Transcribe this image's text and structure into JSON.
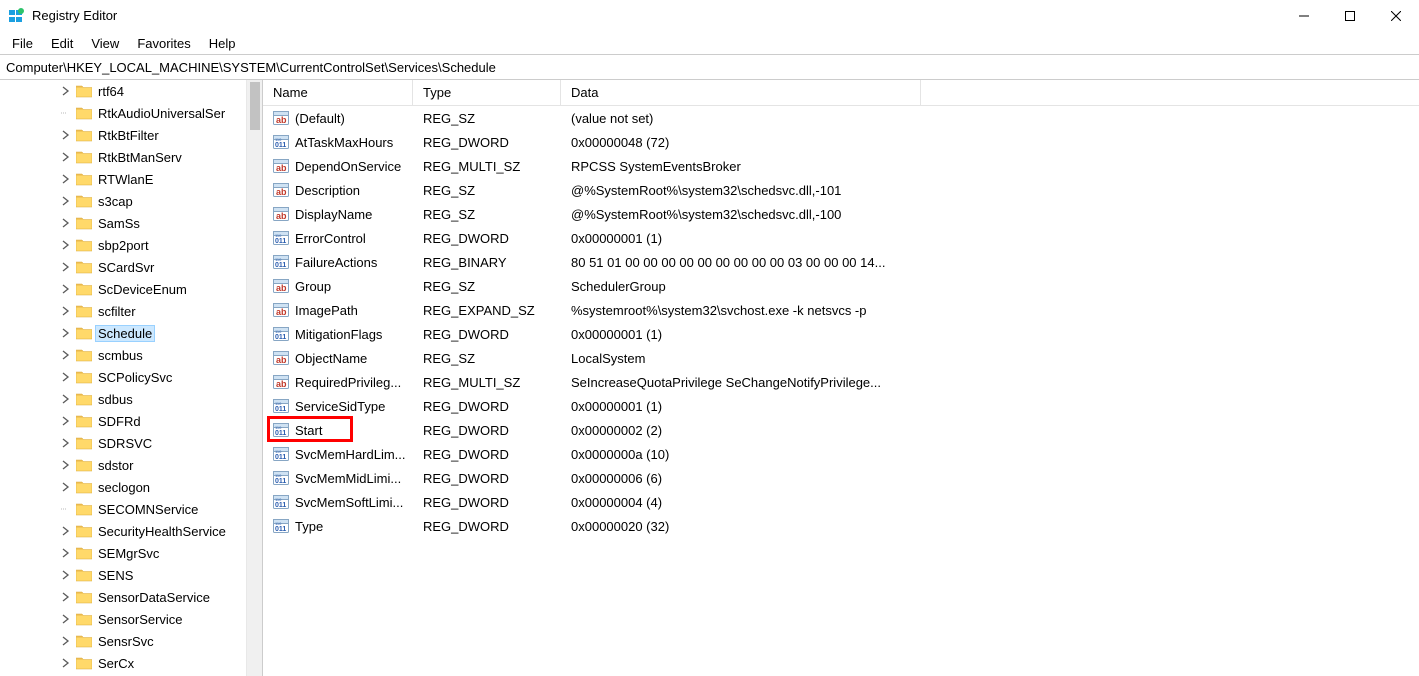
{
  "titlebar": {
    "title": "Registry Editor"
  },
  "menus": [
    "File",
    "Edit",
    "View",
    "Favorites",
    "Help"
  ],
  "address": "Computer\\HKEY_LOCAL_MACHINE\\SYSTEM\\CurrentControlSet\\Services\\Schedule",
  "tree": [
    {
      "label": "rtf64",
      "expandable": true
    },
    {
      "label": "RtkAudioUniversalSer",
      "expandable": false
    },
    {
      "label": "RtkBtFilter",
      "expandable": true
    },
    {
      "label": "RtkBtManServ",
      "expandable": true
    },
    {
      "label": "RTWlanE",
      "expandable": true
    },
    {
      "label": "s3cap",
      "expandable": true
    },
    {
      "label": "SamSs",
      "expandable": true
    },
    {
      "label": "sbp2port",
      "expandable": true
    },
    {
      "label": "SCardSvr",
      "expandable": true
    },
    {
      "label": "ScDeviceEnum",
      "expandable": true
    },
    {
      "label": "scfilter",
      "expandable": true
    },
    {
      "label": "Schedule",
      "expandable": true,
      "selected": true
    },
    {
      "label": "scmbus",
      "expandable": true
    },
    {
      "label": "SCPolicySvc",
      "expandable": true
    },
    {
      "label": "sdbus",
      "expandable": true
    },
    {
      "label": "SDFRd",
      "expandable": true
    },
    {
      "label": "SDRSVC",
      "expandable": true
    },
    {
      "label": "sdstor",
      "expandable": true
    },
    {
      "label": "seclogon",
      "expandable": true
    },
    {
      "label": "SECOMNService",
      "expandable": false
    },
    {
      "label": "SecurityHealthService",
      "expandable": true
    },
    {
      "label": "SEMgrSvc",
      "expandable": true
    },
    {
      "label": "SENS",
      "expandable": true
    },
    {
      "label": "SensorDataService",
      "expandable": true
    },
    {
      "label": "SensorService",
      "expandable": true
    },
    {
      "label": "SensrSvc",
      "expandable": true
    },
    {
      "label": "SerCx",
      "expandable": true
    }
  ],
  "columns": {
    "name": "Name",
    "type": "Type",
    "data": "Data"
  },
  "rows": [
    {
      "icon": "ab",
      "name": "(Default)",
      "type": "REG_SZ",
      "data": "(value not set)"
    },
    {
      "icon": "bin",
      "name": "AtTaskMaxHours",
      "type": "REG_DWORD",
      "data": "0x00000048 (72)"
    },
    {
      "icon": "ab",
      "name": "DependOnService",
      "type": "REG_MULTI_SZ",
      "data": "RPCSS SystemEventsBroker"
    },
    {
      "icon": "ab",
      "name": "Description",
      "type": "REG_SZ",
      "data": "@%SystemRoot%\\system32\\schedsvc.dll,-101"
    },
    {
      "icon": "ab",
      "name": "DisplayName",
      "type": "REG_SZ",
      "data": "@%SystemRoot%\\system32\\schedsvc.dll,-100"
    },
    {
      "icon": "bin",
      "name": "ErrorControl",
      "type": "REG_DWORD",
      "data": "0x00000001 (1)"
    },
    {
      "icon": "bin",
      "name": "FailureActions",
      "type": "REG_BINARY",
      "data": "80 51 01 00 00 00 00 00 00 00 00 00 03 00 00 00 14..."
    },
    {
      "icon": "ab",
      "name": "Group",
      "type": "REG_SZ",
      "data": "SchedulerGroup"
    },
    {
      "icon": "ab",
      "name": "ImagePath",
      "type": "REG_EXPAND_SZ",
      "data": "%systemroot%\\system32\\svchost.exe -k netsvcs -p"
    },
    {
      "icon": "bin",
      "name": "MitigationFlags",
      "type": "REG_DWORD",
      "data": "0x00000001 (1)"
    },
    {
      "icon": "ab",
      "name": "ObjectName",
      "type": "REG_SZ",
      "data": "LocalSystem"
    },
    {
      "icon": "ab",
      "name": "RequiredPrivileg...",
      "type": "REG_MULTI_SZ",
      "data": "SeIncreaseQuotaPrivilege SeChangeNotifyPrivilege..."
    },
    {
      "icon": "bin",
      "name": "ServiceSidType",
      "type": "REG_DWORD",
      "data": "0x00000001 (1)"
    },
    {
      "icon": "bin",
      "name": "Start",
      "type": "REG_DWORD",
      "data": "0x00000002 (2)",
      "highlight": true
    },
    {
      "icon": "bin",
      "name": "SvcMemHardLim...",
      "type": "REG_DWORD",
      "data": "0x0000000a (10)"
    },
    {
      "icon": "bin",
      "name": "SvcMemMidLimi...",
      "type": "REG_DWORD",
      "data": "0x00000006 (6)"
    },
    {
      "icon": "bin",
      "name": "SvcMemSoftLimi...",
      "type": "REG_DWORD",
      "data": "0x00000004 (4)"
    },
    {
      "icon": "bin",
      "name": "Type",
      "type": "REG_DWORD",
      "data": "0x00000020 (32)"
    }
  ]
}
